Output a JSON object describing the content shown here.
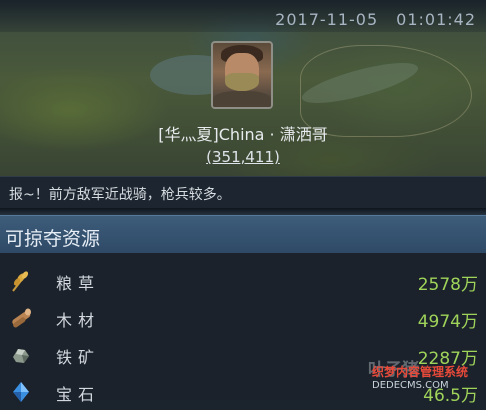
{
  "header": {
    "date": "2017-11-05",
    "time": "01:01:42"
  },
  "player": {
    "name": "[华灬夏]China · 潇洒哥",
    "power": "(351,411)"
  },
  "report": {
    "message": "报~！前方敌军近战骑，枪兵较多。"
  },
  "section": {
    "title": "可掠夺资源"
  },
  "resources": [
    {
      "icon": "grain-icon",
      "name": "粮草",
      "amount": "2578",
      "unit": "万"
    },
    {
      "icon": "wood-icon",
      "name": "木材",
      "amount": "4974",
      "unit": "万"
    },
    {
      "icon": "iron-ore-icon",
      "name": "铁矿",
      "amount": "2287",
      "unit": "万"
    },
    {
      "icon": "gem-icon",
      "name": "宝石",
      "amount": "46.5",
      "unit": "万"
    }
  ],
  "watermark": {
    "brand": "叶子猪",
    "tagline": "织梦内容管理系统",
    "url": "DEDECMS.COM"
  },
  "colors": {
    "amount": "#9fd35a",
    "section_header": "#3d5d7b"
  }
}
